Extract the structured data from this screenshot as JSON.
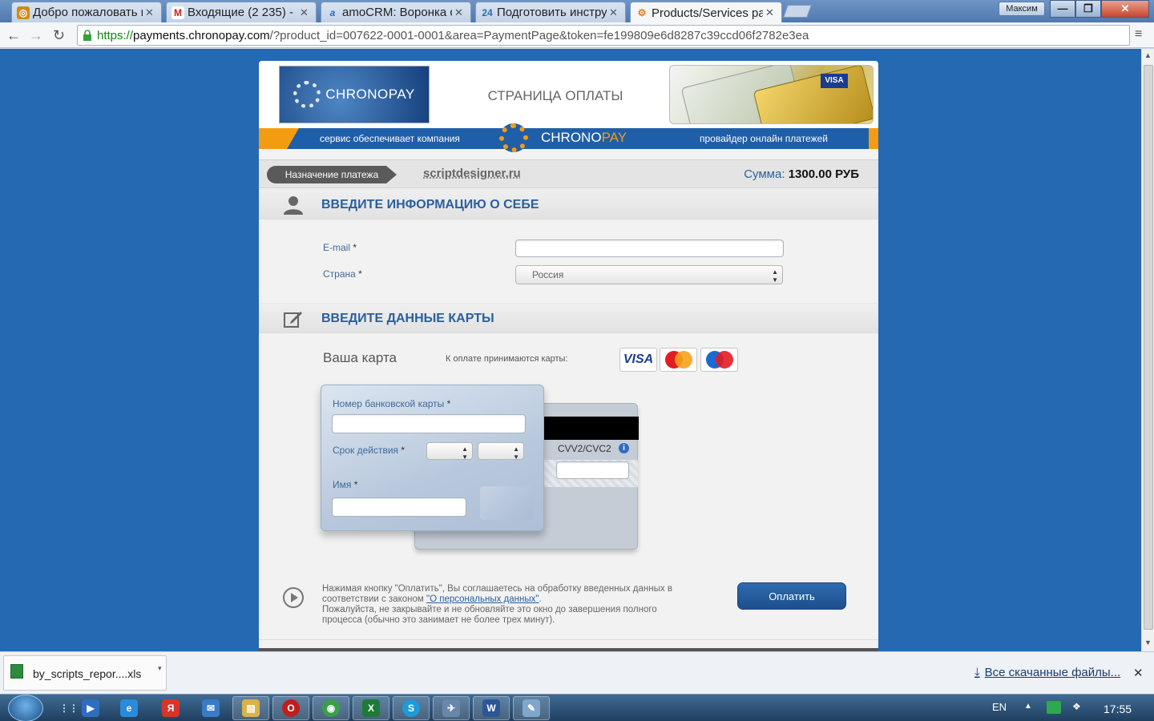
{
  "browser": {
    "tabs": [
      {
        "title": "Добро пожаловать в",
        "favicon": "globe-icon",
        "color": "#d08a1a",
        "glyph": "◎"
      },
      {
        "title": "Входящие (2 235) - ",
        "favicon": "gmail-icon",
        "color": "#c5221f",
        "glyph": "M"
      },
      {
        "title": "amoCRM: Воронка с",
        "favicon": "amocrm-icon",
        "color": "#2b6cb0",
        "glyph": "a"
      },
      {
        "title": "Подготовить инстру",
        "favicon": "bitrix24-icon",
        "color": "#2b6cb0",
        "glyph": "24"
      },
      {
        "title": "Products/Services pa",
        "favicon": "chronopay-icon",
        "color": "#e57c1a",
        "glyph": "⚙"
      }
    ],
    "user": "Максим",
    "window_controls": {
      "minimize": "—",
      "maximize": "❐",
      "close": "✕"
    },
    "url_scheme": "https://",
    "url_host": "payments.chronopay.com",
    "url_rest": "/?product_id=007622-0001-0001&area=PaymentPage&token=fe199809e6d8287c39ccd06f2782e3ea",
    "nav": {
      "back": "←",
      "forward": "→",
      "reload": "↻"
    },
    "ext_glyph": "V",
    "star_glyph": "☆",
    "menu_glyph": "≡"
  },
  "header": {
    "logo_text": "CHRONOPAY",
    "page_title": "СТРАНИЦА ОПЛАТЫ",
    "cards_visa": "VISA",
    "strip_left": "сервис обеспечивает компания",
    "strip_brand_white": "CHRONO",
    "strip_brand_orange": "PAY",
    "strip_right": "провайдер онлайн платежей"
  },
  "purpose": {
    "label": "Назначение платежа",
    "site": "scriptdesigner.ru",
    "sum_label": "Сумма:",
    "sum_value": "1300.00 РУБ"
  },
  "section_info": {
    "title": "ВВЕДИТЕ ИНФОРМАЦИЮ О СЕБЕ",
    "email_label": "E-mail",
    "email_value": "",
    "country_label": "Страна",
    "country_value": "Россия",
    "req": "*"
  },
  "section_card": {
    "title": "ВВЕДИТЕ ДАННЫЕ КАРТЫ",
    "your_card": "Ваша карта",
    "accepted": "К оплате принимаются карты:",
    "brands": [
      "VISA",
      "MasterCard",
      "Maestro"
    ],
    "number_label": "Номер банковской карты",
    "expiry_label": "Срок действия",
    "name_label": "Имя",
    "cvv_label": "CVV2/CVC2",
    "info_glyph": "i",
    "req": "*"
  },
  "agree": {
    "text1": "Нажимая кнопку \"Оплатить\", Вы соглашаетесь на обработку введенных данных в соответствии с законом ",
    "link": "\"О персональных данных\"",
    "text2": ".",
    "text3": "Пожалуйста, не закрывайте и не обновляйте это окно до завершения полного процесса (обычно это занимает не более трех минут).",
    "pay_button": "Оплатить"
  },
  "downloads": {
    "file": "by_scripts_repor....xls",
    "all": "Все скачанные файлы...",
    "close": "✕",
    "arrow": "⤓",
    "dropdown": "▾"
  },
  "taskbar": {
    "apps": [
      {
        "name": "show-desktop",
        "glyph": "⋮⋮",
        "color": "transparent"
      },
      {
        "name": "media-player",
        "glyph": "▶",
        "color": "#2f6dc0"
      },
      {
        "name": "internet-explorer",
        "glyph": "e",
        "color": "#2a8bd8"
      },
      {
        "name": "yandex-browser",
        "glyph": "Я",
        "color": "#d8342a"
      },
      {
        "name": "mail-app",
        "glyph": "✉",
        "color": "#3a7bc8"
      },
      {
        "name": "file-explorer",
        "glyph": "▤",
        "color": "#d9b24a"
      },
      {
        "name": "opera",
        "glyph": "O",
        "color": "#c01e1e"
      },
      {
        "name": "chrome",
        "glyph": "◉",
        "color": "#3aa048"
      },
      {
        "name": "excel",
        "glyph": "X",
        "color": "#1f7a3a"
      },
      {
        "name": "skype",
        "glyph": "S",
        "color": "#1d9bd8"
      },
      {
        "name": "network-tool",
        "glyph": "✈",
        "color": "#6a86a8"
      },
      {
        "name": "word",
        "glyph": "W",
        "color": "#2b5797"
      },
      {
        "name": "notes-app",
        "glyph": "✎",
        "color": "#7fa7cc"
      }
    ],
    "lang": "EN",
    "tray_up": "▲",
    "clock": "17:55"
  }
}
